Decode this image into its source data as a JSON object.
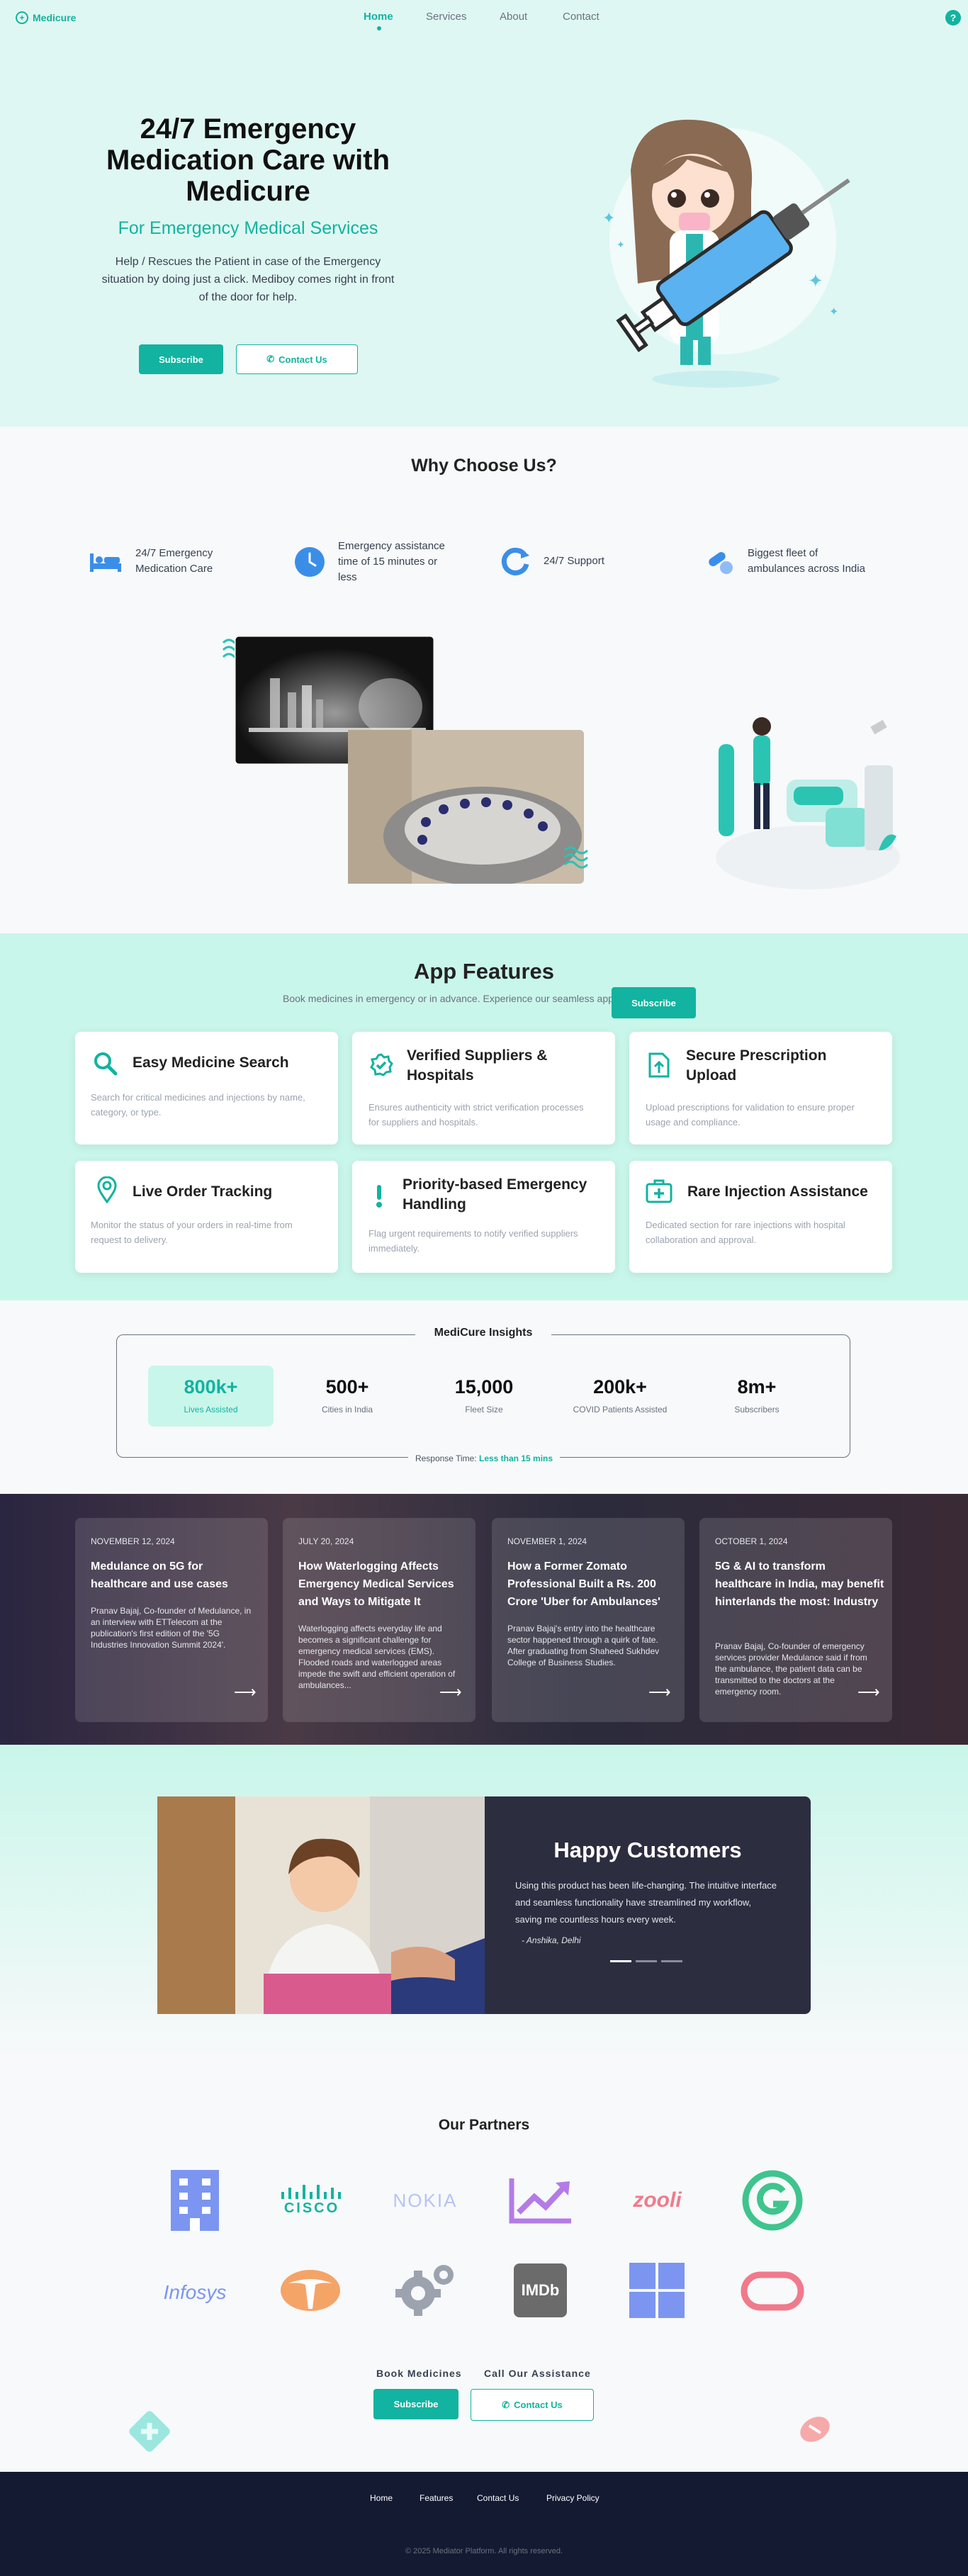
{
  "header": {
    "brand": "Medicure",
    "nav": [
      "Home",
      "Services",
      "About",
      "Contact"
    ],
    "help_glyph": "?"
  },
  "hero": {
    "title": "24/7 Emergency Medication Care with Medicure",
    "subtitle": "For Emergency Medical Services",
    "description": "Help / Rescues the Patient in case of the Emergency situation by doing just a click. Mediboy comes right in front of the door for help.",
    "subscribe": "Subscribe",
    "contact": "Contact Us"
  },
  "why": {
    "title": "Why Choose Us?",
    "items": [
      {
        "icon": "bed-icon",
        "label": "24/7 Emergency Medication Care"
      },
      {
        "icon": "clock-icon",
        "label": "Emergency assistance time of 15 minutes or less"
      },
      {
        "icon": "refresh-icon",
        "label": "24/7 Support"
      },
      {
        "icon": "pills-icon",
        "label": "Biggest fleet of ambulances across India"
      }
    ]
  },
  "features": {
    "title": "App Features",
    "subtitle": "Book medicines in emergency or in advance. Experience our seamless app.",
    "subscribe": "Subscribe",
    "cards": [
      {
        "icon": "search-icon",
        "title": "Easy Medicine Search",
        "desc": "Search for critical medicines and injections by name, category, or type."
      },
      {
        "icon": "verified-icon",
        "title": "Verified Suppliers & Hospitals",
        "desc": "Ensures authenticity with strict verification processes for suppliers and hospitals."
      },
      {
        "icon": "upload-icon",
        "title": "Secure Prescription Upload",
        "desc": "Upload prescriptions for validation to ensure proper usage and compliance."
      },
      {
        "icon": "location-pin-icon",
        "title": "Live Order Tracking",
        "desc": "Monitor the status of your orders in real-time from request to delivery."
      },
      {
        "icon": "exclamation-icon",
        "title": "Priority-based Emergency Handling",
        "desc": "Flag urgent requirements to notify verified suppliers immediately."
      },
      {
        "icon": "medical-kit-icon",
        "title": "Rare Injection Assistance",
        "desc": "Dedicated section for rare injections with hospital collaboration and approval."
      }
    ]
  },
  "insights": {
    "title": "MediCure Insights",
    "stats": [
      {
        "value": "800k+",
        "label": "Lives Assisted"
      },
      {
        "value": "500+",
        "label": "Cities in India"
      },
      {
        "value": "15,000",
        "label": "Fleet Size"
      },
      {
        "value": "200k+",
        "label": "COVID Patients Assisted"
      },
      {
        "value": "8m+",
        "label": "Subscribers"
      }
    ],
    "response_label": "Response Time:",
    "response_value": "Less than 15 mins"
  },
  "news": [
    {
      "date": "NOVEMBER 12, 2024",
      "title": "Medulance on 5G for healthcare and use cases",
      "text": "Pranav Bajaj, Co-founder of Medulance, in an interview with ETTelecom at the publication's first edition of the '5G Industries Innovation Summit 2024'."
    },
    {
      "date": "JULY 20, 2024",
      "title": "How Waterlogging Affects Emergency Medical Services and Ways to Mitigate It",
      "text": "Waterlogging affects everyday life and becomes a significant challenge for emergency medical services (EMS). Flooded roads and waterlogged areas impede the swift and efficient operation of ambulances..."
    },
    {
      "date": "NOVEMBER 1, 2024",
      "title": "How a Former Zomato Professional Built a Rs. 200 Crore 'Uber for Ambulances'",
      "text": "Pranav Bajaj's entry into the healthcare sector happened through a quirk of fate. After graduating from Shaheed Sukhdev College of Business Studies."
    },
    {
      "date": "OCTOBER 1, 2024",
      "title": "5G & AI to transform healthcare in India, may benefit hinterlands the most: Industry",
      "text": "Pranav Bajaj, Co-founder of emergency services provider Medulance said if from the ambulance, the patient data can be transmitted to the doctors at the emergency room."
    }
  ],
  "testimonial": {
    "title": "Happy Customers",
    "quote": "Using this product has been life-changing. The intuitive interface and seamless functionality have streamlined my workflow, saving me countless hours every week.",
    "author": "- Anshika, Delhi",
    "active_slide": 1,
    "slide_count": 3
  },
  "partners": {
    "title": "Our Partners",
    "logos": [
      {
        "name": "building-logo",
        "color": "#7c95f0"
      },
      {
        "name": "cisco-logo",
        "text": "CISCO",
        "color": "#16b3a0"
      },
      {
        "name": "nokia-logo",
        "text": "NOKIA",
        "color": "#b7c3f5"
      },
      {
        "name": "chart-up-logo",
        "color": "#b47be6"
      },
      {
        "name": "zomato-logo",
        "text": "zooli",
        "color": "#f07a8c"
      },
      {
        "name": "grammarly-logo",
        "color": "#3fc48d"
      },
      {
        "name": "infosys-logo",
        "text": "Infosys",
        "color": "#7c95f0"
      },
      {
        "name": "tata-logo",
        "color": "#f5a468"
      },
      {
        "name": "gears-logo",
        "color": "#9ca3af"
      },
      {
        "name": "imdb-logo",
        "text": "IMDb",
        "color": "#6b6b6b"
      },
      {
        "name": "windows-logo",
        "color": "#7c95f0"
      },
      {
        "name": "capsule-logo",
        "color": "#f07a8c"
      }
    ]
  },
  "cta": {
    "book": "Book Medicines",
    "call": "Call Our Assistance",
    "subscribe": "Subscribe",
    "contact": "Contact Us"
  },
  "footer": {
    "links": [
      "Home",
      "Features",
      "Contact Us",
      "Privacy Policy"
    ],
    "copyright": "© 2025 Mediator Platform. All rights reserved."
  },
  "colors": {
    "accent": "#12b3a0",
    "dark": "#151a33",
    "mint": "#c9f6ea"
  }
}
